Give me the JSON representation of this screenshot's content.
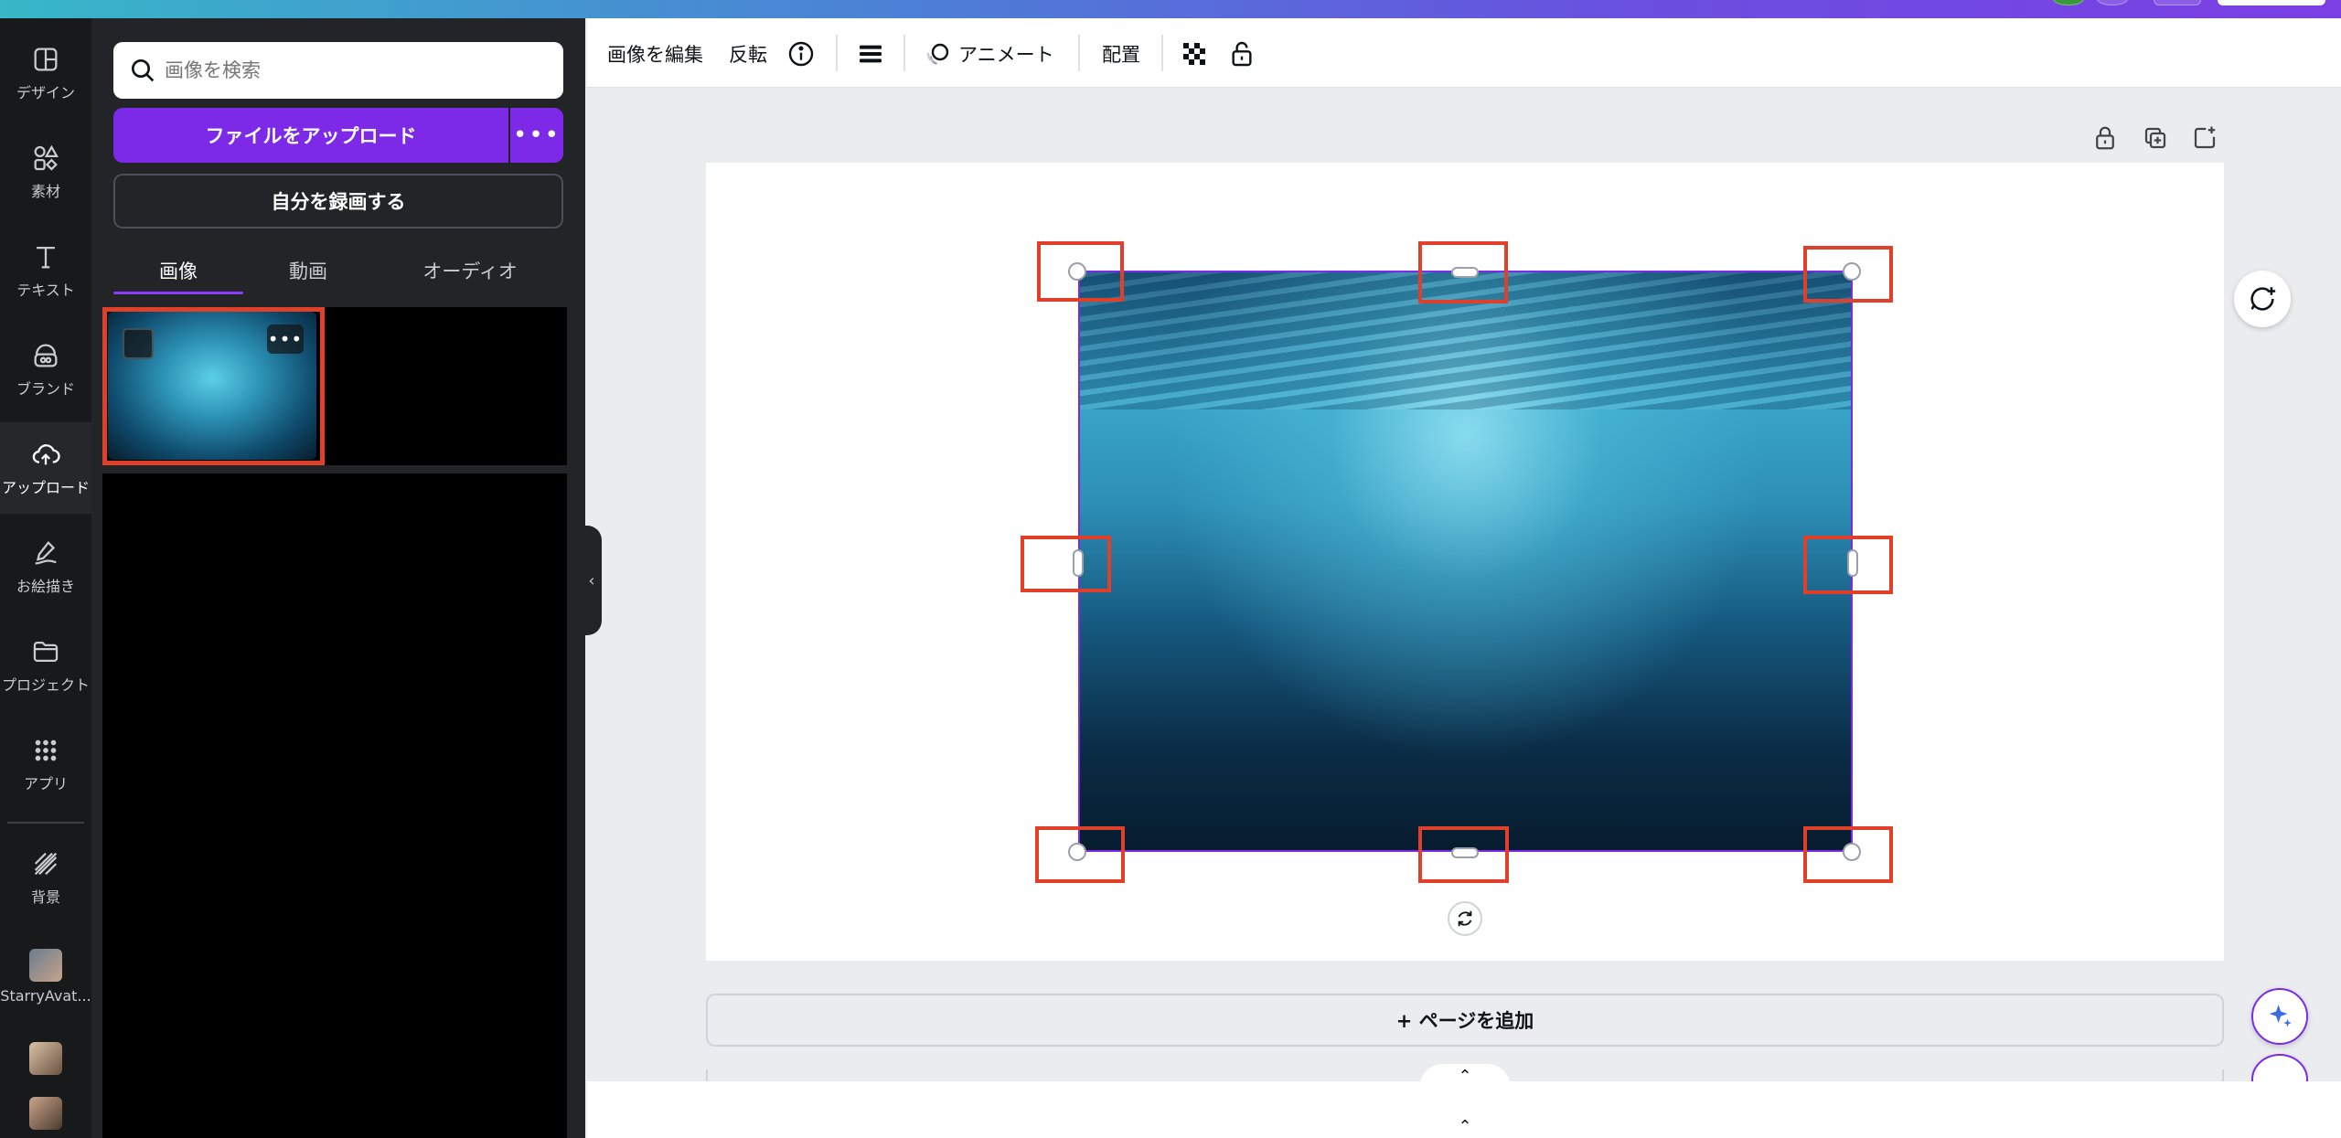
{
  "rail": {
    "items": [
      {
        "label": "デザイン",
        "icon": "design-icon"
      },
      {
        "label": "素材",
        "icon": "elements-icon"
      },
      {
        "label": "テキスト",
        "icon": "text-icon"
      },
      {
        "label": "ブランド",
        "icon": "brand-icon"
      },
      {
        "label": "アップロード",
        "icon": "upload-cloud-icon"
      },
      {
        "label": "お絵描き",
        "icon": "draw-icon"
      },
      {
        "label": "プロジェクト",
        "icon": "folder-icon"
      },
      {
        "label": "アプリ",
        "icon": "apps-icon"
      },
      {
        "label": "背景",
        "icon": "background-icon"
      },
      {
        "label": "StarryAvat...",
        "icon": "starry-avatar-app-icon"
      }
    ]
  },
  "panel": {
    "search_placeholder": "画像を検索",
    "upload_label": "ファイルをアップロード",
    "record_label": "自分を録画する",
    "tabs": [
      "画像",
      "動画",
      "オーディオ"
    ],
    "active_tab": "画像"
  },
  "toolbar": {
    "edit_image": "画像を編集",
    "flip": "反転",
    "animate": "アニメート",
    "position": "配置"
  },
  "canvas": {
    "add_page": "+ ページを追加",
    "highlight_color": "#e0402a",
    "selection_color": "#7d2ae8"
  }
}
